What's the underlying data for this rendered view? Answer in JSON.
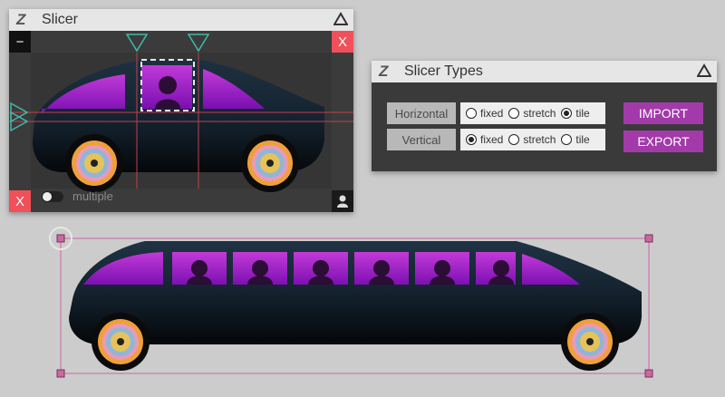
{
  "slicer": {
    "title": "Slicer",
    "logo": "Z",
    "minus_label": "−",
    "close_label": "X",
    "close_bottom_label": "X",
    "multiple_label": "multiple",
    "multiple_on": false,
    "icons": [
      "collapse-triangle-icon",
      "person-icon"
    ]
  },
  "slicer_types": {
    "title": "Slicer Types",
    "logo": "Z",
    "rows": [
      {
        "label": "Horizontal",
        "options": [
          "fixed",
          "stretch",
          "tile"
        ],
        "selected": "tile"
      },
      {
        "label": "Vertical",
        "options": [
          "fixed",
          "stretch",
          "tile"
        ],
        "selected": "fixed"
      }
    ],
    "import_label": "IMPORT",
    "export_label": "EXPORT"
  },
  "colors": {
    "accent_purple": "#a23ba9",
    "close_red": "#f0505a",
    "guide_teal": "#3fb9a8",
    "selection_pink": "#c76a9e"
  }
}
